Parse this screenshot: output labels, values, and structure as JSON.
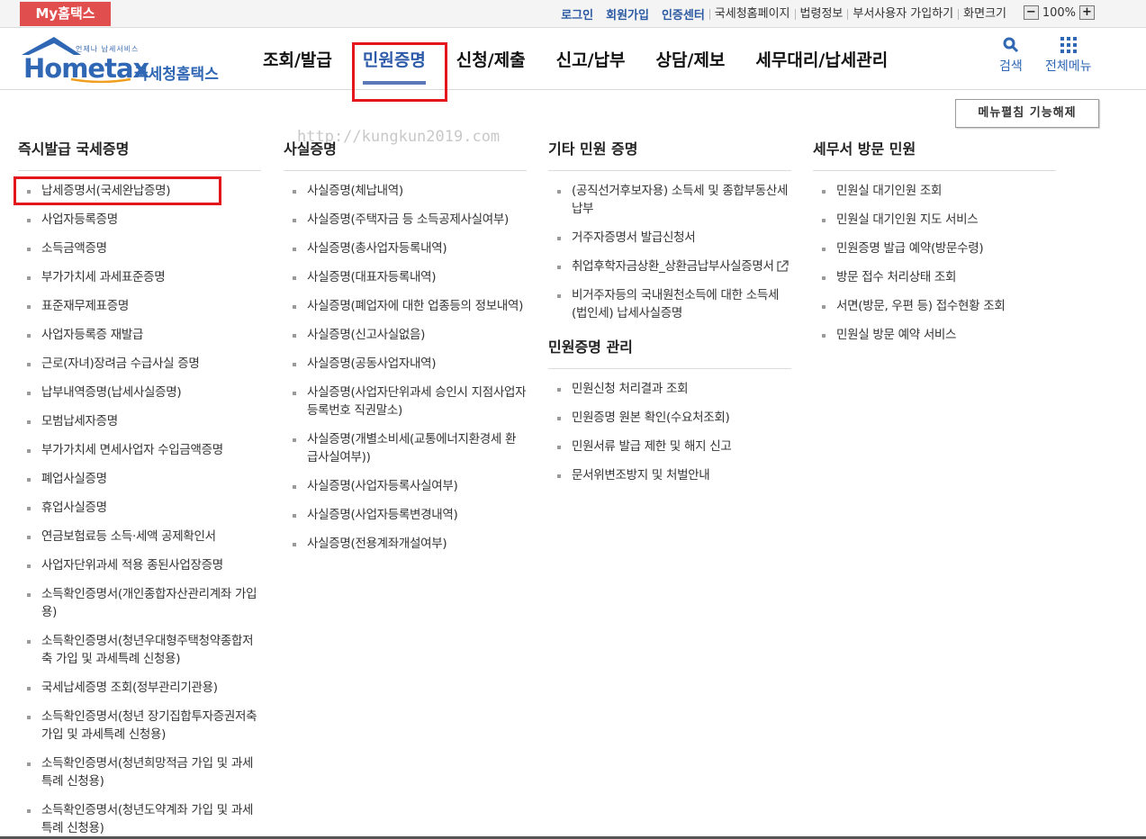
{
  "topbar": {
    "my_button": "My홈택스",
    "login": "로그인",
    "signup": "회원가입",
    "cert": "인증센터",
    "links": [
      "국세청홈페이지",
      "법령정보",
      "부서사용자 가입하기",
      "화면크기"
    ],
    "zoom_value": "100%",
    "zoom_minus": "−",
    "zoom_plus": "+"
  },
  "logo": {
    "sub": "언제나 납세서비스",
    "main": "Hometax",
    "kor": "국세청홈택스"
  },
  "gnb": [
    "조회/발급",
    "민원증명",
    "신청/제출",
    "신고/납부",
    "상담/제보",
    "세무대리/납세관리"
  ],
  "gnb_active": "민원증명",
  "tools": {
    "search": "검색",
    "allmenu": "전체메뉴"
  },
  "fold_button": "메뉴펼침 기능해제",
  "watermark": "http://kungkun2019.com",
  "columns": [
    {
      "title": "즉시발급 국세증명",
      "items": [
        "납세증명서(국세완납증명)",
        "사업자등록증명",
        "소득금액증명",
        "부가가치세 과세표준증명",
        "표준재무제표증명",
        "사업자등록증 재발급",
        "근로(자녀)장려금 수급사실 증명",
        "납부내역증명(납세사실증명)",
        "모범납세자증명",
        "부가가치세 면세사업자 수입금액증명",
        "폐업사실증명",
        "휴업사실증명",
        "연금보험료등 소득·세액 공제확인서",
        "사업자단위과세 적용 종된사업장증명",
        "소득확인증명서(개인종합자산관리계좌 가입용)",
        "소득확인증명서(청년우대형주택청약종합저축 가입 및 과세특례 신청용)",
        "국세납세증명 조회(정부관리기관용)",
        "소득확인증명서(청년 장기집합투자증권저축가입 및 과세특례 신청용)",
        "소득확인증명서(청년희망적금 가입 및 과세특례 신청용)",
        "소득확인증명서(청년도약계좌 가입 및 과세특례 신청용)"
      ]
    },
    {
      "title": "사실증명",
      "items": [
        "사실증명(체납내역)",
        "사실증명(주택자금 등 소득공제사실여부)",
        "사실증명(총사업자등록내역)",
        "사실증명(대표자등록내역)",
        "사실증명(폐업자에 대한 업종등의 정보내역)",
        "사실증명(신고사실없음)",
        "사실증명(공동사업자내역)",
        "사실증명(사업자단위과세 승인시 지점사업자등록번호 직권말소)",
        "사실증명(개별소비세(교통에너지환경세 환급사실여부))",
        "사실증명(사업자등록사실여부)",
        "사실증명(사업자등록변경내역)",
        "사실증명(전용계좌개설여부)"
      ]
    },
    {
      "title": "기타 민원 증명",
      "items": [
        "(공직선거후보자용) 소득세 및 종합부동산세 납부",
        "거주자증명서 발급신청서",
        "취업후학자금상환_상환금납부사실증명서",
        "비거주자등의 국내원천소득에 대한 소득세(법인세) 납세사실증명"
      ],
      "title2": "민원증명 관리",
      "items2": [
        "민원신청 처리결과 조회",
        "민원증명 원본 확인(수요처조회)",
        "민원서류 발급 제한 및 해지 신고",
        "문서위변조방지 및 처벌안내"
      ]
    },
    {
      "title": "세무서 방문 민원",
      "items": [
        "민원실 대기인원 조회",
        "민원실 대기인원 지도 서비스",
        "민원증명 발급 예약(방문수령)",
        "방문 접수 처리상태 조회",
        "서면(방문, 우편 등) 접수현황 조회",
        "민원실 방문 예약 서비스"
      ]
    }
  ]
}
